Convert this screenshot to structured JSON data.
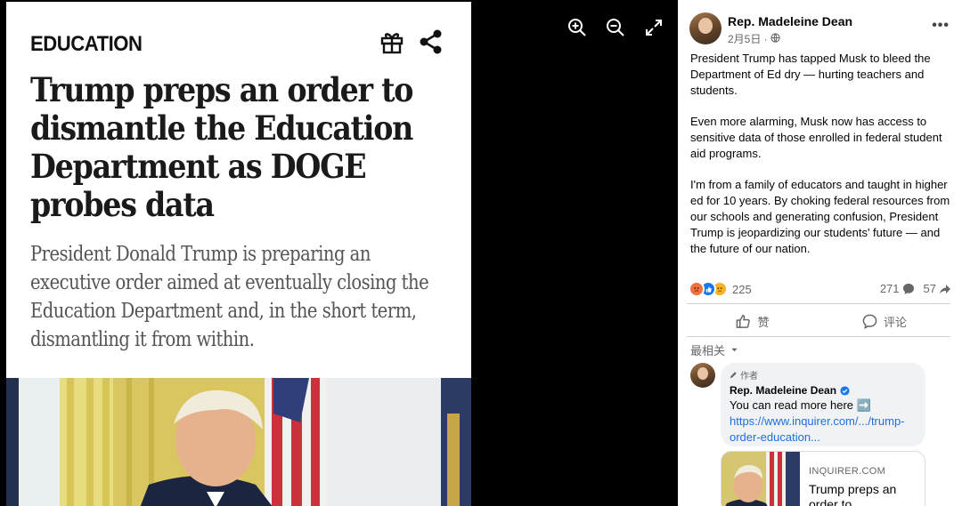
{
  "viewer": {
    "controls": [
      {
        "name": "zoom-in-icon"
      },
      {
        "name": "zoom-out-icon"
      },
      {
        "name": "expand-icon"
      }
    ]
  },
  "article": {
    "section": "EDUCATION",
    "headline": "Trump preps an order to dismantle the Education Department as DOGE probes data",
    "dek": "President Donald Trump is preparing an executive order aimed at eventually closing the Education Department and, in the short term, dismantling it from within.",
    "icons": [
      "gift-icon",
      "share-icon"
    ]
  },
  "post": {
    "author": "Rep. Madeleine Dean",
    "date": "2月5日 ·",
    "paragraphs": [
      "President Trump has tapped Musk to bleed the Department of Ed dry — hurting teachers and students.",
      "Even more alarming, Musk now has access to sensitive data of those enrolled in federal student aid programs.",
      "I'm from a family of educators and taught in higher ed for 10 years. By choking federal resources from our schools and generating confusion, President Trump is jeopardizing our students' future — and the future of our nation."
    ],
    "reaction_count": "225",
    "comment_count": "271",
    "share_count": "57",
    "like_label": "赞",
    "comment_label": "评论",
    "sort_label": "最相关",
    "colors": {
      "angry": "#f0713a",
      "like": "#1877f2",
      "sad": "#f7b125"
    }
  },
  "comment": {
    "badge": "作者",
    "author": "Rep. Madeleine Dean",
    "text": "You can read more here ➡️",
    "link": "https://www.inquirer.com/.../trump-order-education..."
  },
  "link_card": {
    "site": "INQUIRER.COM",
    "title": "Trump preps an order to..."
  }
}
